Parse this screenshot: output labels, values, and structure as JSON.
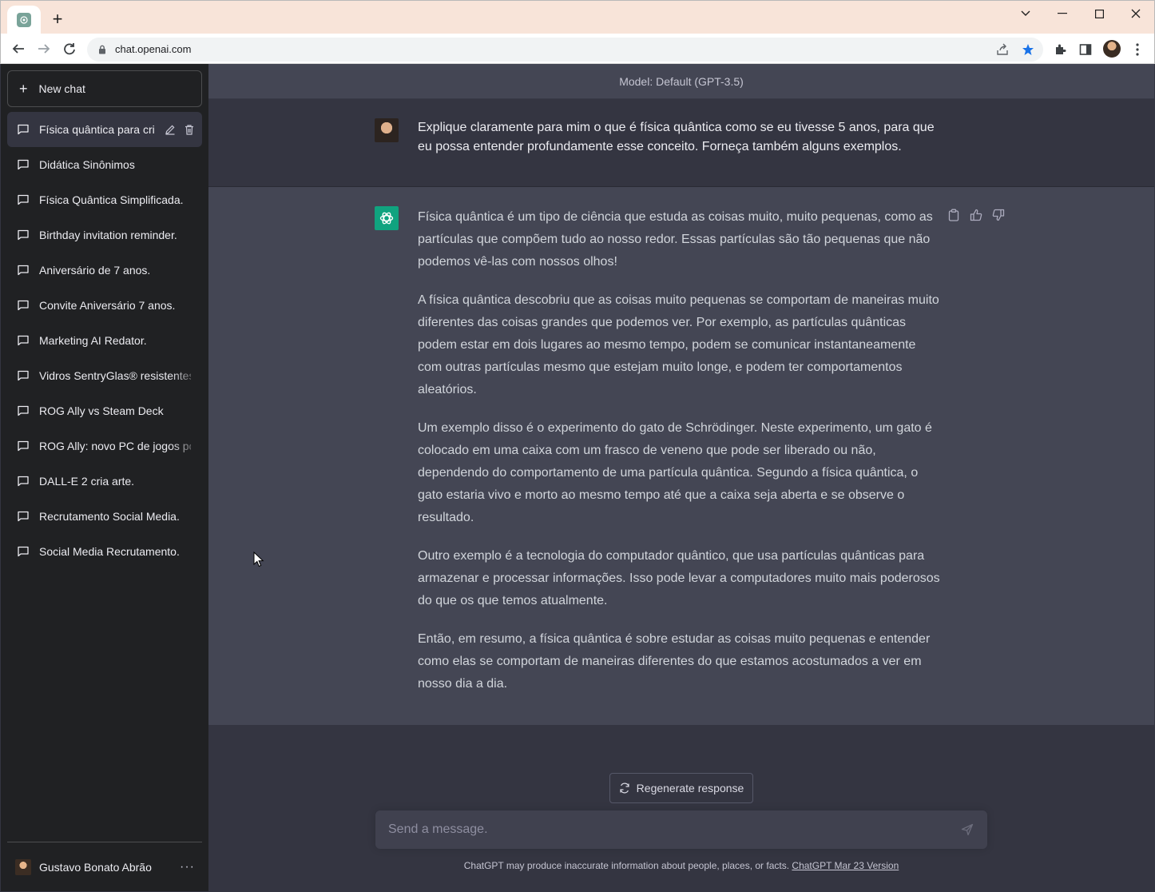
{
  "browser": {
    "url": "chat.openai.com",
    "new_tab": "+"
  },
  "sidebar": {
    "new_chat_label": "New chat",
    "items": [
      {
        "label": "Física quântica para cri"
      },
      {
        "label": "Didática Sinônimos"
      },
      {
        "label": "Física Quântica Simplificada."
      },
      {
        "label": "Birthday invitation reminder."
      },
      {
        "label": "Aniversário de 7 anos."
      },
      {
        "label": "Convite Aniversário 7 anos."
      },
      {
        "label": "Marketing AI Redator."
      },
      {
        "label": "Vidros SentryGlas® resistentes"
      },
      {
        "label": "ROG Ally vs Steam Deck"
      },
      {
        "label": "ROG Ally: novo PC de jogos po"
      },
      {
        "label": "DALL-E 2 cria arte."
      },
      {
        "label": "Recrutamento Social Media."
      },
      {
        "label": "Social Media Recrutamento."
      }
    ],
    "user_name": "Gustavo Bonato Abrão",
    "more": "···"
  },
  "main": {
    "model_label": "Model: Default (GPT-3.5)",
    "user_message": "Explique claramente para mim o que é física quântica como se eu tivesse 5 anos, para que eu possa entender profundamente esse conceito. Forneça também alguns exemplos.",
    "bot_paragraphs": [
      "Física quântica é um tipo de ciência que estuda as coisas muito, muito pequenas, como as partículas que compõem tudo ao nosso redor. Essas partículas são tão pequenas que não podemos vê-las com nossos olhos!",
      "A física quântica descobriu que as coisas muito pequenas se comportam de maneiras muito diferentes das coisas grandes que podemos ver. Por exemplo, as partículas quânticas podem estar em dois lugares ao mesmo tempo, podem se comunicar instantaneamente com outras partículas mesmo que estejam muito longe, e podem ter comportamentos aleatórios.",
      "Um exemplo disso é o experimento do gato de Schrödinger. Neste experimento, um gato é colocado em uma caixa com um frasco de veneno que pode ser liberado ou não, dependendo do comportamento de uma partícula quântica. Segundo a física quântica, o gato estaria vivo e morto ao mesmo tempo até que a caixa seja aberta e se observe o resultado.",
      "Outro exemplo é a tecnologia do computador quântico, que usa partículas quânticas para armazenar e processar informações. Isso pode levar a computadores muito mais poderosos do que os que temos atualmente.",
      "Então, em resumo, a física quântica é sobre estudar as coisas muito pequenas e entender como elas se comportam de maneiras diferentes do que estamos acostumados a ver em nosso dia a dia."
    ],
    "regenerate_label": "Regenerate response",
    "composer_placeholder": "Send a message.",
    "disclaimer": "ChatGPT may produce inaccurate information about people, places, or facts. ",
    "version_link": "ChatGPT Mar 23 Version"
  },
  "colors": {
    "sidebar_bg": "#202123",
    "main_bg": "#343541",
    "bot_bg": "#444654",
    "accent": "#10a37f",
    "titlebar": "#f8e4d9"
  }
}
